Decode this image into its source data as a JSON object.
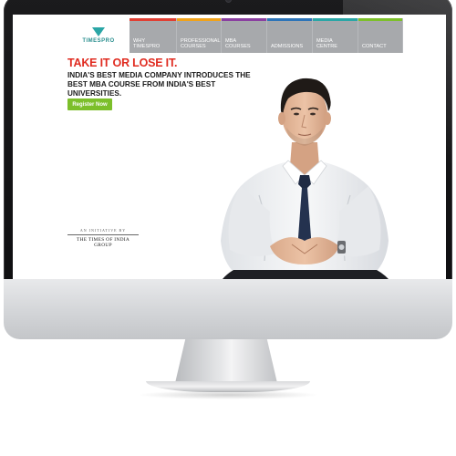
{
  "nav": {
    "logo_text": "TIMESPRO",
    "items": [
      {
        "label": "WHY TIMESPRO",
        "bar_color": "#e03f33"
      },
      {
        "label": "PROFESSIONAL COURSES",
        "bar_color": "#f0a21a"
      },
      {
        "label": "MBA COURSES",
        "bar_color": "#8a3fa0"
      },
      {
        "label": "ADMISSIONS",
        "bar_color": "#2d74b8"
      },
      {
        "label": "MEDIA CENTRE",
        "bar_color": "#2aa6a6"
      },
      {
        "label": "CONTACT",
        "bar_color": "#7cbf2a"
      }
    ]
  },
  "hero": {
    "headline": "TAKE IT OR LOSE IT.",
    "subline": "INDIA'S BEST MEDIA COMPANY INTRODUCES THE BEST MBA COURSE FROM INDIA'S BEST UNIVERSITIES.",
    "cta_label": "Register Now"
  },
  "footer": {
    "initiative_label": "AN INITIATIVE BY",
    "group_name": "THE TIMES OF INDIA GROUP"
  },
  "colors": {
    "accent_red": "#e02b20",
    "cta_green": "#7cbf2a",
    "nav_gray": "#a7a9ac"
  }
}
